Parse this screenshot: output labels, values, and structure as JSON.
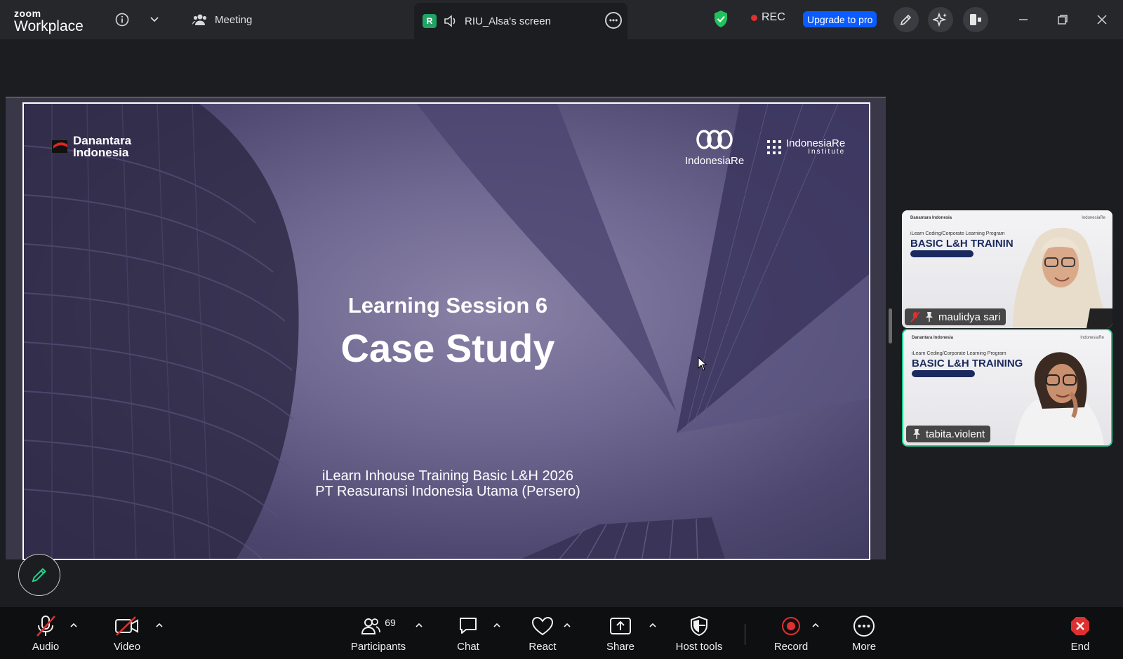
{
  "app": {
    "brand_top": "zoom",
    "brand_bottom": "Workplace"
  },
  "topbar": {
    "meeting_label": "Meeting",
    "share_badge": "R",
    "share_title": "RIU_Alsa's screen",
    "rec_label": "REC",
    "upgrade_label": "Upgrade to pro"
  },
  "slide": {
    "logo_left": [
      "Danantara",
      "Indonesia"
    ],
    "logo_center": "IndonesiaRe",
    "logo_right_name": "IndonesiaRe",
    "logo_right_sub": "Institute",
    "kicker": "Learning Session 6",
    "title": "Case Study",
    "subtitle_line1": "iLearn Inhouse Training Basic L&H 2026",
    "subtitle_line2": "PT Reasuransi Indonesia Utama (Persero)"
  },
  "participants": [
    {
      "name": "maulidya sari",
      "slide_program": "iLearn Ceding/Corporate Learning Program",
      "slide_title": "BASIC L&H TRAININ",
      "slide_head": "Danantara Indonesia",
      "slide_ire": "IndonesiaRe",
      "muted": true,
      "active": false
    },
    {
      "name": "tabita.violent",
      "slide_program": "iLearn Ceding/Corporate Learning Program",
      "slide_title": "BASIC L&H TRAINING",
      "slide_head": "Danantara Indonesia",
      "slide_ire": "IndonesiaRe",
      "muted": false,
      "active": true
    }
  ],
  "toolbar": {
    "audio": "Audio",
    "video": "Video",
    "participants": "Participants",
    "participants_count": "69",
    "chat": "Chat",
    "react": "React",
    "share": "Share",
    "host_tools": "Host tools",
    "record": "Record",
    "more": "More",
    "end": "End"
  },
  "colors": {
    "accent_blue": "#0b5cff",
    "active_green": "#23d18b",
    "record_red": "#e02f2f",
    "security_green": "#21c25e"
  }
}
